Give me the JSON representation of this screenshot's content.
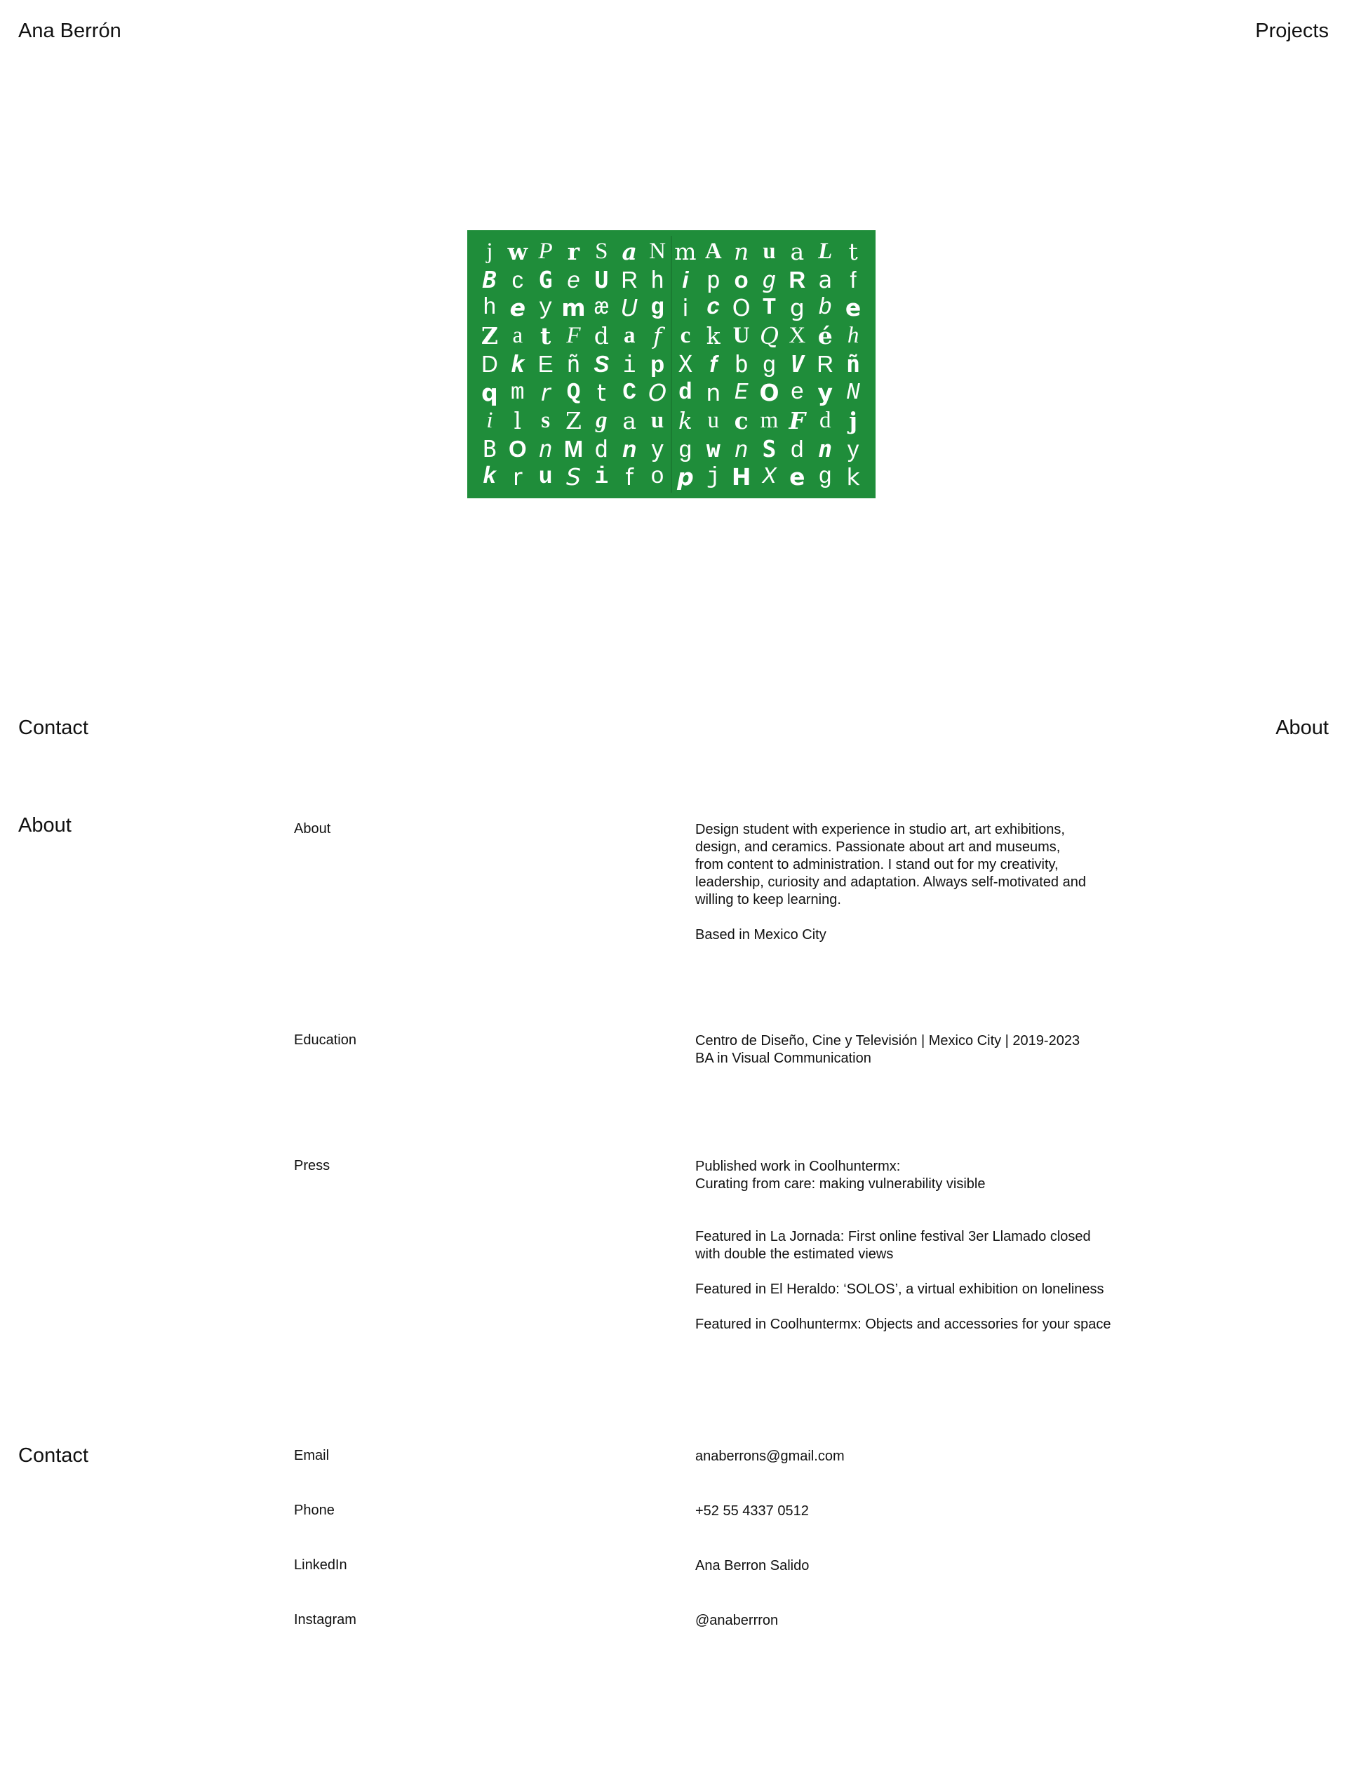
{
  "header": {
    "site_name": "Ana Berrón",
    "projects_link": "Projects"
  },
  "nav": {
    "contact_link": "Contact",
    "about_link": "About"
  },
  "hero": {
    "glyph_rows": [
      [
        "j",
        "w",
        "P",
        "r",
        "S",
        "a",
        "N",
        "m",
        "A",
        "n",
        "u",
        "a",
        "L",
        "t"
      ],
      [
        "B",
        "c",
        "G",
        "e",
        "U",
        "R",
        "h",
        "i",
        "p",
        "o",
        "g",
        "R",
        "a",
        "f"
      ],
      [
        "h",
        "e",
        "y",
        "m",
        "æ",
        "U",
        "g",
        "i",
        "c",
        "O",
        "T",
        "g",
        "b",
        "e"
      ],
      [
        "Z",
        "a",
        "t",
        "F",
        "d",
        "a",
        "f",
        "c",
        "k",
        "U",
        "Q",
        "X",
        "é",
        "h"
      ],
      [
        "D",
        "k",
        "E",
        "ñ",
        "S",
        "i",
        "p",
        "X",
        "f",
        "b",
        "g",
        "V",
        "R",
        "ñ"
      ],
      [
        "q",
        "m",
        "r",
        "Q",
        "t",
        "C",
        "O",
        "d",
        "n",
        "E",
        "O",
        "e",
        "y",
        "N"
      ],
      [
        "i",
        "l",
        "s",
        "Z",
        "g",
        "a",
        "u",
        "k",
        "u",
        "c",
        "m",
        "F",
        "d",
        "j"
      ],
      [
        "B",
        "O",
        "n",
        "M",
        "d",
        "n",
        "y",
        "g",
        "w",
        "n",
        "S",
        "d",
        "n",
        "y"
      ],
      [
        "k",
        "r",
        "u",
        "S",
        "i",
        "f",
        "o",
        "p",
        "j",
        "H",
        "X",
        "e",
        "g",
        "k"
      ]
    ],
    "accent_color": "#1f8d3a"
  },
  "about": {
    "section_title": "About",
    "rows": [
      {
        "label": "About",
        "paragraphs": [
          "Design student with experience in studio art, art exhibitions, design, and ceramics. Passionate about art and museums, from content to administration. I stand out for my creativity, leadership, curiosity and adaptation. Always self-motivated and willing to keep learning.",
          "Based in Mexico City"
        ]
      },
      {
        "label": "Education",
        "paragraphs": [
          "Centro de Diseño, Cine y Televisión | Mexico City | 2019-2023",
          "BA in Visual Communication"
        ]
      },
      {
        "label": "Press",
        "paragraphs": [
          "Published work in Coolhuntermx:",
          "Curating from care: making vulnerability visible",
          "Featured in La Jornada: First online festival 3er Llamado closed with double the estimated views",
          "Featured in El Heraldo: ‘SOLOS’, a virtual exhibition on loneliness",
          "Featured in Coolhuntermx: Objects and accessories for your space"
        ]
      }
    ]
  },
  "contact": {
    "section_title": "Contact",
    "rows": [
      {
        "label": "Email",
        "value": "anaberrons@gmail.com"
      },
      {
        "label": "Phone",
        "value": "+52 55 4337 0512"
      },
      {
        "label": "LinkedIn",
        "value": "Ana Berron Salido"
      },
      {
        "label": "Instagram",
        "value": "@anaberrron"
      }
    ]
  }
}
